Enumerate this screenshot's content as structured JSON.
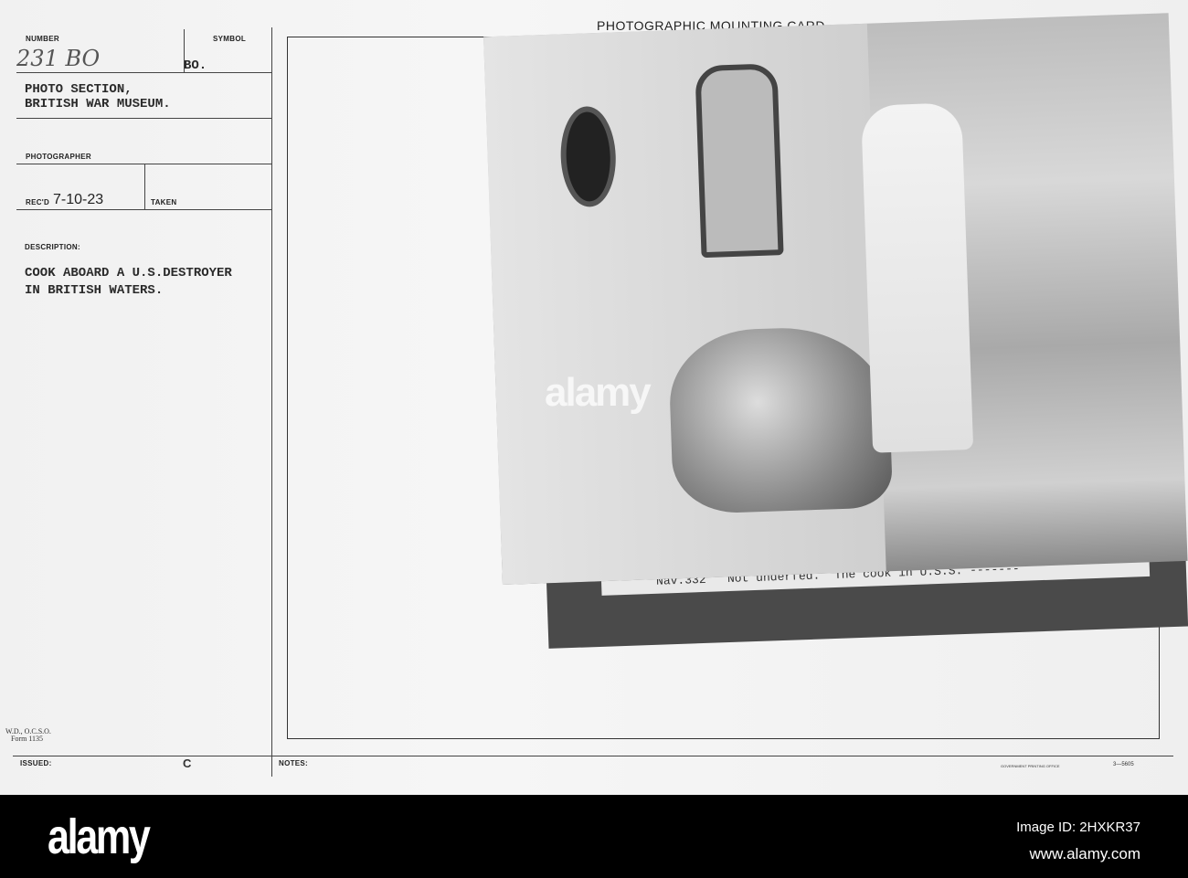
{
  "card": {
    "title": "PHOTOGRAPHIC MOUNTING CARD",
    "number_label": "NUMBER",
    "number_value": "231 BO",
    "symbol_label": "SYMBOL",
    "symbol_value": "BO.",
    "section": [
      "PHOTO SECTION,",
      "BRITISH WAR MUSEUM."
    ],
    "photographer_label": "PHOTOGRAPHER",
    "recd_label": "REC'D",
    "recd_value": "7-10-23",
    "taken_label": "TAKEN",
    "description_label": "DESCRIPTION:",
    "description": [
      "COOK ABOARD A U.S.DESTROYER",
      "IN BRITISH WATERS."
    ],
    "form": [
      "W.D., O.C.S.O.",
      "Form 1135"
    ],
    "issued_label": "ISSUED:",
    "issued_value": "C",
    "notes_label": "NOTES:",
    "printer": "GOVERNMENT PRINTING OFFICE",
    "printer_code": "3—5605"
  },
  "photo": {
    "caption": "Nav.332   Not underfed.  The cook in U.S.S. -------"
  },
  "watermark": "alamy",
  "footer": {
    "logo": "alamy",
    "image_id": "Image ID: 2HXKR37",
    "url": "www.alamy.com"
  }
}
